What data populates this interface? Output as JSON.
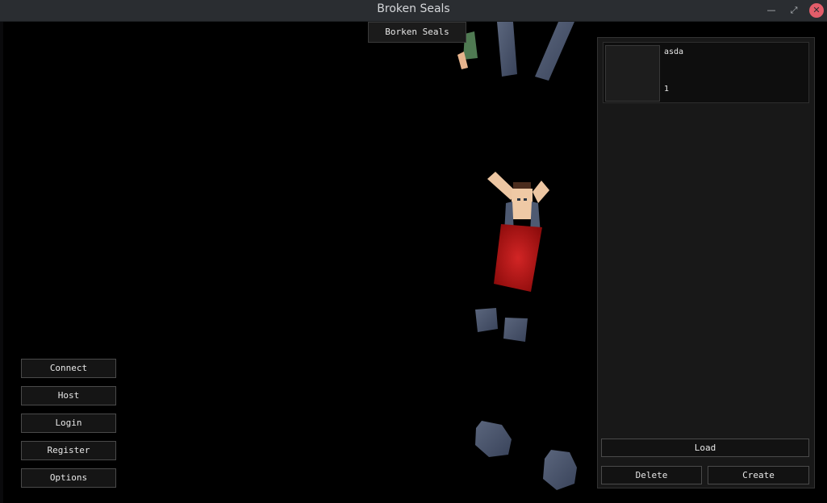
{
  "window": {
    "title": "Broken Seals",
    "minimize_glyph": "—",
    "maximize_glyph": "⤢",
    "close_glyph": "✕"
  },
  "game_label": "Borken Seals",
  "main_menu": {
    "buttons": [
      "Connect",
      "Host",
      "Login",
      "Register",
      "Options"
    ]
  },
  "character_panel": {
    "characters": [
      {
        "name": "asda",
        "level": "1"
      }
    ],
    "load_label": "Load",
    "delete_label": "Delete",
    "create_label": "Create"
  },
  "colors": {
    "titlebar": "#2a2d31",
    "close_button": "#e35d6a",
    "panel": "#181818",
    "button_border": "#4a4a4a",
    "character_robe": "#b31616",
    "rock": "#4a5670"
  },
  "icons": {
    "minimize": "minimize-icon",
    "maximize": "maximize-icon",
    "close": "close-icon"
  }
}
